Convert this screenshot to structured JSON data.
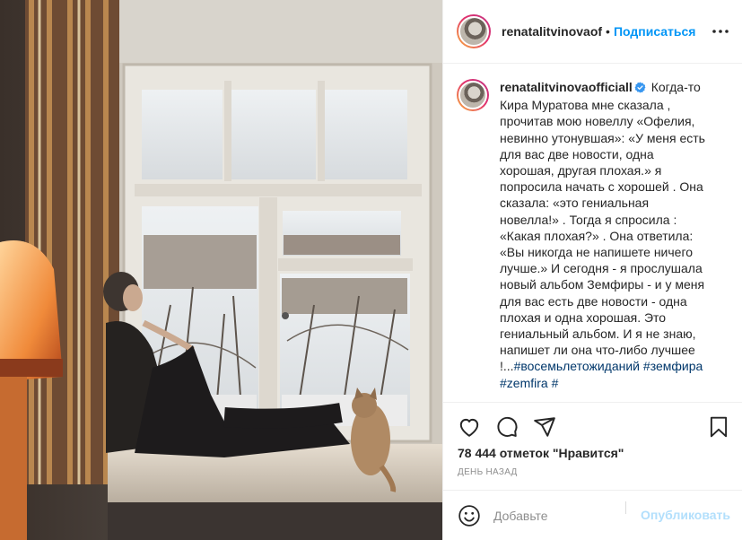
{
  "header": {
    "username": "renatalitvinovaоf",
    "separator": "•",
    "follow_label": "Подписаться",
    "more_icon": "more-horizontal-icon"
  },
  "caption": {
    "username": "renatalitvinovaofficiall",
    "verified_icon": "verified-badge-icon",
    "lines": [
      "Когда-то",
      "Кира Муратова мне сказала ,",
      "прочитав мою новеллу «Офелия,",
      "невинно утонувшая»: «У меня есть",
      "для вас две новости, одна",
      "хорошая, другая плохая.» я",
      "попросила начать с хорошей . Она",
      "сказала: «это гениальная",
      "новелла!» . Тогда я спросила :",
      "«Какая плохая?» . Она ответила:",
      "«Вы никогда не напишете ничего",
      "лучше.» И сегодня - я прослушала",
      "новый альбом Земфиры - и у меня",
      "для вас есть две новости - одна",
      "плохая и одна хорошая. Это",
      "гениальный альбом. И я не знаю,",
      "напишет ли она что-либо лучшее"
    ],
    "last_line_prefix": "!...",
    "hashtags": [
      "#восемьлетожиданий",
      "#земфира",
      "#zemfira",
      "#"
    ]
  },
  "actions": {
    "like_icon": "heart-icon",
    "comment_icon": "comment-icon",
    "share_icon": "share-icon",
    "save_icon": "bookmark-icon"
  },
  "likes_text": "78 444 отметок \"Нравится\"",
  "date_text": "ДЕНЬ НАЗАД",
  "comment": {
    "emoji_icon": "emoji-icon",
    "placeholder": "Добавьте",
    "publish_label": "Опубликовать"
  },
  "colors": {
    "link_blue": "#0095f6",
    "hashtag": "#00376b",
    "publish_disabled": "#b2dffc",
    "muted": "#8e8e8e"
  }
}
